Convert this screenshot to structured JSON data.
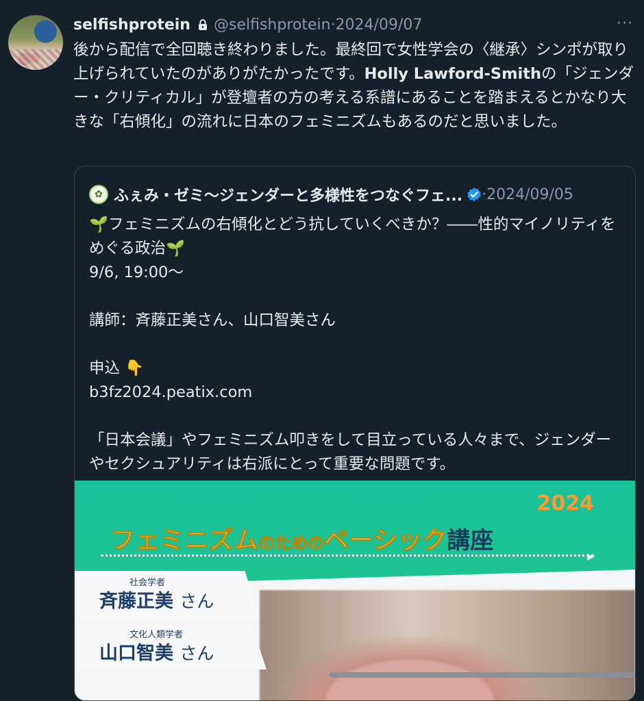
{
  "tweet": {
    "display_name": "selfishprotein",
    "handle": "@selfishprotein",
    "separator": "·",
    "date": "2024/09/07",
    "more_label": "···",
    "text_part1": "後から配信で全回聴き終わりました。最終回で女性学会の〈継承〉シンポが取り上げられていたのがありがたかったです。",
    "text_bold": "Holly Lawford-Smith",
    "text_part2": "の「ジェンダー・クリティカル」が登壇者の方の考える系譜にあることを踏まえるとかなり大きな「右傾化」の流れに日本のフェミニズムもあるのだと思いました。"
  },
  "quote": {
    "display_name": "ふぇみ・ゼミ〜ジェンダーと多様性をつなぐフェ...",
    "separator": "·",
    "date": "2024/09/05",
    "line1": "フェミニズムの右傾化とどう抗していくべきか？――性的マイノリティをめぐる政治",
    "line2": "9/6, 19:00〜",
    "line3": "講師：斉藤正美さん、山口智美さん",
    "line4": "申込",
    "line5": "b3fz2024.peatix.com",
    "line6": "「日本会議」やフェミニズム叩きをして目立っている人々まで、ジェンダーやセクシュアリティは右派にとって重要な問題です。",
    "image": {
      "year": "2024",
      "title_part1": "フェミニズム",
      "title_part2": "のための",
      "title_part3": "ベーシック",
      "title_part4": "講座",
      "speaker1_role": "社会学者",
      "speaker1_name": "斉藤正美",
      "speaker2_role": "文化人類学者",
      "speaker2_name": "山口智美",
      "honorific": "さん"
    }
  },
  "colors": {
    "background": "#15202b",
    "text": "#e7e9ea",
    "secondary": "#8b98a5",
    "verified": "#1d9bf0"
  },
  "icons": [
    "lock-icon",
    "verified-badge-icon",
    "more-options-icon",
    "seedling-emoji",
    "pointing-down-emoji"
  ]
}
